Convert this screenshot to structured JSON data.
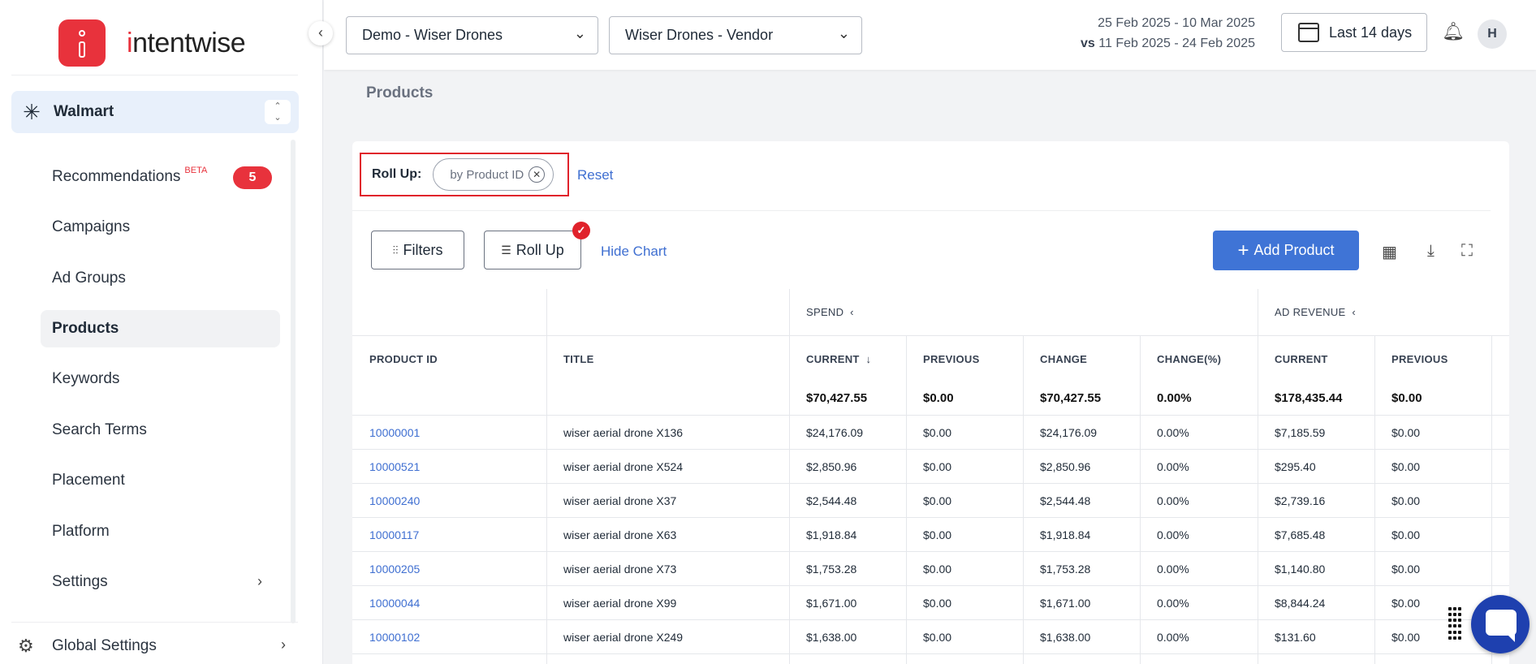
{
  "sidebar": {
    "logo_text_i": "i",
    "logo_text_rest": "ntentwise",
    "platform": "Walmart",
    "items": [
      {
        "label": "Recommendations",
        "beta": "BETA",
        "badge": "5"
      },
      {
        "label": "Campaigns"
      },
      {
        "label": "Ad Groups"
      },
      {
        "label": "Products",
        "active": true
      },
      {
        "label": "Keywords"
      },
      {
        "label": "Search Terms"
      },
      {
        "label": "Placement"
      },
      {
        "label": "Platform"
      },
      {
        "label": "Settings"
      }
    ],
    "global_settings": "Global Settings"
  },
  "header": {
    "account": "Demo - Wiser Drones",
    "profile": "Wiser Drones - Vendor",
    "date_range": "25 Feb 2025 - 10 Mar 2025",
    "compare_prefix": "vs",
    "compare_range": "11 Feb 2025 - 24 Feb 2025",
    "period_button": "Last 14 days",
    "avatar_initial": "H"
  },
  "page": {
    "title": "Products"
  },
  "toolbar": {
    "rollup_label": "Roll Up:",
    "rollup_chip": "by Product ID",
    "reset": "Reset",
    "filters": "Filters",
    "rollup_button": "Roll Up",
    "hide_chart": "Hide Chart",
    "add_product": "Add Product"
  },
  "table": {
    "groups": {
      "spend": "SPEND",
      "ad_revenue": "AD REVENUE"
    },
    "columns": [
      "PRODUCT ID",
      "TITLE",
      "CURRENT",
      "PREVIOUS",
      "CHANGE",
      "CHANGE(%)",
      "CURRENT",
      "PREVIOUS"
    ],
    "totals": [
      "",
      "",
      "$70,427.55",
      "$0.00",
      "$70,427.55",
      "0.00%",
      "$178,435.44",
      "$0.00"
    ],
    "rows": [
      [
        "10000001",
        "wiser aerial drone X136",
        "$24,176.09",
        "$0.00",
        "$24,176.09",
        "0.00%",
        "$7,185.59",
        "$0.00"
      ],
      [
        "10000521",
        "wiser aerial drone X524",
        "$2,850.96",
        "$0.00",
        "$2,850.96",
        "0.00%",
        "$295.40",
        "$0.00"
      ],
      [
        "10000240",
        "wiser aerial drone X37",
        "$2,544.48",
        "$0.00",
        "$2,544.48",
        "0.00%",
        "$2,739.16",
        "$0.00"
      ],
      [
        "10000117",
        "wiser aerial drone X63",
        "$1,918.84",
        "$0.00",
        "$1,918.84",
        "0.00%",
        "$7,685.48",
        "$0.00"
      ],
      [
        "10000205",
        "wiser aerial drone X73",
        "$1,753.28",
        "$0.00",
        "$1,753.28",
        "0.00%",
        "$1,140.80",
        "$0.00"
      ],
      [
        "10000044",
        "wiser aerial drone X99",
        "$1,671.00",
        "$0.00",
        "$1,671.00",
        "0.00%",
        "$8,844.24",
        "$0.00"
      ],
      [
        "10000102",
        "wiser aerial drone X249",
        "$1,638.00",
        "$0.00",
        "$1,638.00",
        "0.00%",
        "$131.60",
        "$0.00"
      ]
    ]
  },
  "colors": {
    "brand": "#e8323c",
    "accent": "#3f74d6",
    "link": "#3f6fd1"
  },
  "icons": [
    "walmart-spark-icon",
    "calendar-icon",
    "bell-icon",
    "gear-icon",
    "filters-icon",
    "rollup-icon",
    "table-view-icon",
    "download-icon",
    "fullscreen-icon",
    "sort-down-icon",
    "chat-icon"
  ]
}
